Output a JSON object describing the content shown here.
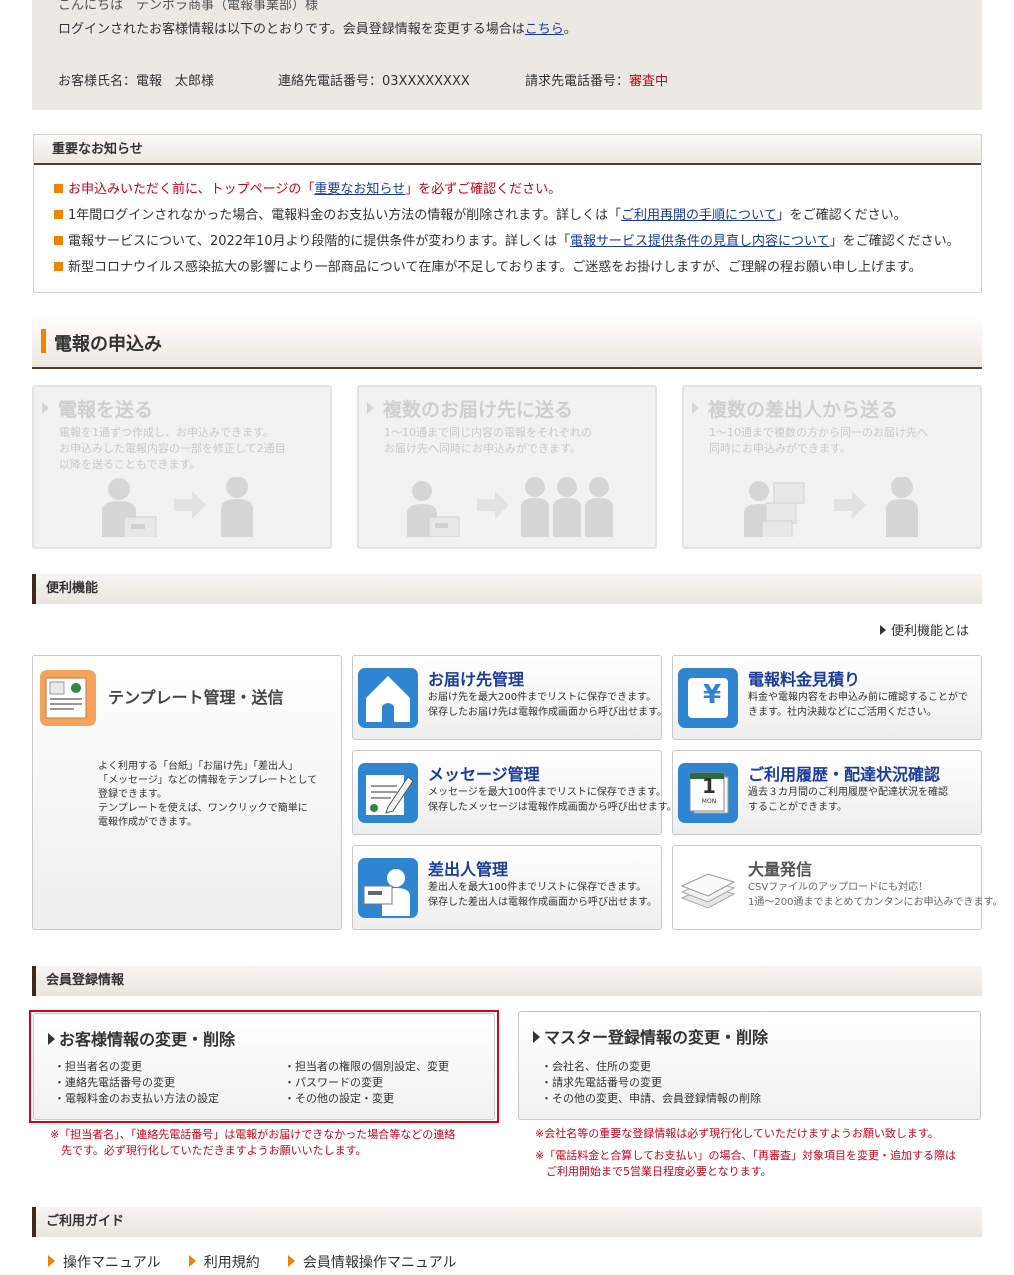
{
  "info": {
    "greeting": "こんにちは　テンポラ商事（電報事業部）様",
    "intro_text": "ログインされたお客様情報は以下のとおりです。会員登録情報を変更する場合は",
    "intro_link": "こちら",
    "intro_end": "。",
    "customer_name": "お客様氏名：電報　太郎様",
    "contact_phone": "連絡先電話番号：03XXXXXXXX",
    "billing_label": "請求先電話番号：",
    "billing_status": "審査中"
  },
  "notice": {
    "title": "重要なお知らせ",
    "items": [
      {
        "pre": "お申込みいただく前に、トップページの「",
        "link": "重要なお知らせ",
        "post": "」を必ずご確認ください。",
        "red": true
      },
      {
        "pre": "1年間ログインされなかった場合、電報料金のお支払い方法の情報が削除されます。詳しくは「",
        "link": "ご利用再開の手順について",
        "post": "」をご確認ください。",
        "red": false
      },
      {
        "pre": "電報サービスについて、2022年10月より段階的に提供条件が変わります。詳しくは「",
        "link": "電報サービス提供条件の見直し内容について",
        "post": "」をご確認ください。",
        "red": false
      },
      {
        "pre": "新型コロナウイルス感染拡大の影響により一部商品について在庫が不足しております。ご迷惑をお掛けしますが、ご理解の程お願い申し上げます。",
        "link": "",
        "post": "",
        "red": false
      }
    ]
  },
  "apply": {
    "title": "電報の申込み",
    "cards": [
      {
        "title": "電報を送る",
        "desc": [
          "電報を1通ずつ作成し、お申込みできます。",
          "お申込みした電報内容の一部を修正して2通目",
          "以降を送ることもできます。"
        ]
      },
      {
        "title": "複数のお届け先に送る",
        "desc": [
          "1～10通まで同じ内容の電報をそれぞれの",
          "お届け先へ同時にお申込みができます。"
        ]
      },
      {
        "title": "複数の差出人から送る",
        "desc": [
          "1～10通まで複数の方から同一のお届け先へ",
          "同時にお申込みができます。"
        ]
      }
    ]
  },
  "features": {
    "title": "便利機能",
    "about_link": "便利機能とは",
    "template": {
      "title": "テンプレート管理・送信",
      "desc": [
        "よく利用する「台紙」「お届け先」「差出人」",
        "「メッセージ」などの情報をテンプレートとして",
        "登録できます。",
        "テンプレートを使えば、ワンクリックで簡単に",
        "電報作成ができます。"
      ]
    },
    "cards": [
      {
        "title": "お届け先管理",
        "desc": [
          "お届け先を最大200件までリストに保存できます。",
          "保存したお届け先は電報作成画面から呼び出せます。"
        ]
      },
      {
        "title": "電報料金見積り",
        "desc": [
          "料金や電報内容をお申込み前に確認することがで",
          "きます。社内決裁などにご活用ください。"
        ]
      },
      {
        "title": "メッセージ管理",
        "desc": [
          "メッセージを最大100件までリストに保存できます。",
          "保存したメッセージは電報作成画面から呼び出せます。"
        ]
      },
      {
        "title": "ご利用履歴・配達状況確認",
        "desc": [
          "過去３カ月間のご利用履歴や配達状況を確認",
          "することができます。"
        ]
      },
      {
        "title": "差出人管理",
        "desc": [
          "差出人を最大100件までリストに保存できます。",
          "保存した差出人は電報作成画面から呼び出せます。"
        ]
      },
      {
        "title": "大量発信",
        "desc": [
          "CSVファイルのアップロードにも対応！",
          "1通～200通までまとめてカンタンにお申込みできます。"
        ]
      }
    ],
    "calendar_day": "1",
    "calendar_weekday": "MON",
    "yen_symbol": "¥"
  },
  "member": {
    "title": "会員登録情報",
    "customer_card": {
      "title": "お客様情報の変更・削除",
      "items": [
        "・担当者名の変更",
        "・連絡先電話番号の変更",
        "・電報料金のお支払い方法の設定",
        "・担当者の権限の個別設定、変更",
        "・パスワードの変更",
        "・その他の設定・変更"
      ]
    },
    "master_card": {
      "title": "マスター登録情報の変更・削除",
      "items": [
        "・会社名、住所の変更",
        "・請求先電話番号の変更",
        "・その他の変更、申請、会員登録情報の削除"
      ]
    },
    "note_left": [
      "※「担当者名」、「連絡先電話番号」は電報がお届けできなかった場合等などの連絡",
      "　先です。必ず現行化していただきますようお願いいたします。"
    ],
    "note_right_1": "※会社名等の重要な登録情報は必ず現行化していただけますようお願い致します。",
    "note_right_2": [
      "※「電話料金と合算してお支払い」の場合、「再審査」対象項目を変更・追加する際は",
      "　ご利用開始まで5営業日程度必要となります。"
    ]
  },
  "guide": {
    "title": "ご利用ガイド",
    "links": [
      "操作マニュアル",
      "利用規約",
      "会員情報操作マニュアル"
    ]
  },
  "colors": {
    "accent_orange": "#f08300",
    "link_blue": "#1a3c9e",
    "alert_red": "#d0021b",
    "highlight_border": "#d9001b"
  }
}
